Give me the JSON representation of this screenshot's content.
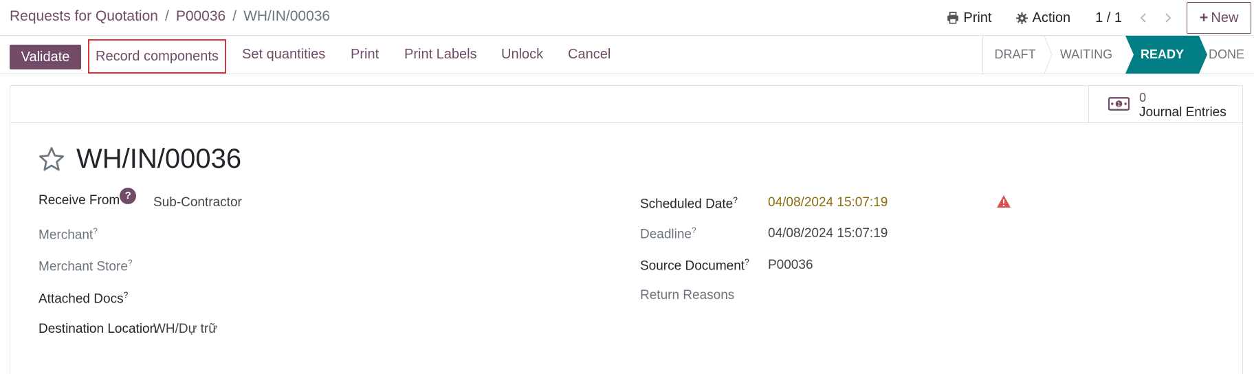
{
  "breadcrumb": {
    "items": [
      "Requests for Quotation",
      "P00036"
    ],
    "separator": "/",
    "current": "WH/IN/00036"
  },
  "top_actions": {
    "print_label": "Print",
    "action_label": "Action",
    "pager": "1 / 1",
    "new_label": "New"
  },
  "control": {
    "validate_label": "Validate",
    "record_components_label": "Record components",
    "set_quantities_label": "Set quantities",
    "print_label": "Print",
    "print_labels_label": "Print Labels",
    "unlock_label": "Unlock",
    "cancel_label": "Cancel"
  },
  "status": {
    "stages": [
      "Draft",
      "Waiting",
      "Ready",
      "Done"
    ],
    "active": "Ready",
    "active_color": "#017e84"
  },
  "smart_button": {
    "value": "0",
    "label": "Journal Entries"
  },
  "record": {
    "title": "WH/IN/00036"
  },
  "fields_left": {
    "receive_from_label": "Receive From",
    "receive_from_help": "?",
    "receive_from_value": "Sub-Contractor",
    "merchant_label": "Merchant",
    "merchant_store_label": "Merchant Store",
    "attached_docs_label": "Attached Docs",
    "destination_label": "Destination Location",
    "destination_value": "WH/Dự trữ"
  },
  "fields_right": {
    "scheduled_label": "Scheduled Date",
    "scheduled_value": "04/08/2024 15:07:19",
    "deadline_label": "Deadline",
    "deadline_value": "04/08/2024 15:07:19",
    "source_label": "Source Document",
    "source_value": "P00036",
    "return_reasons_label": "Return Reasons"
  },
  "help_marker": "?",
  "colors": {
    "brand": "#714B67",
    "ready": "#017e84",
    "warning": "#d9534f",
    "date_warning": "#8a6d0b",
    "highlight_border": "#d9363e"
  },
  "icons": {
    "print": "printer-icon",
    "action": "gear-icon",
    "new": "plus-icon",
    "favorite": "star-icon",
    "journal": "money-icon",
    "alert": "warning-triangle-icon"
  }
}
